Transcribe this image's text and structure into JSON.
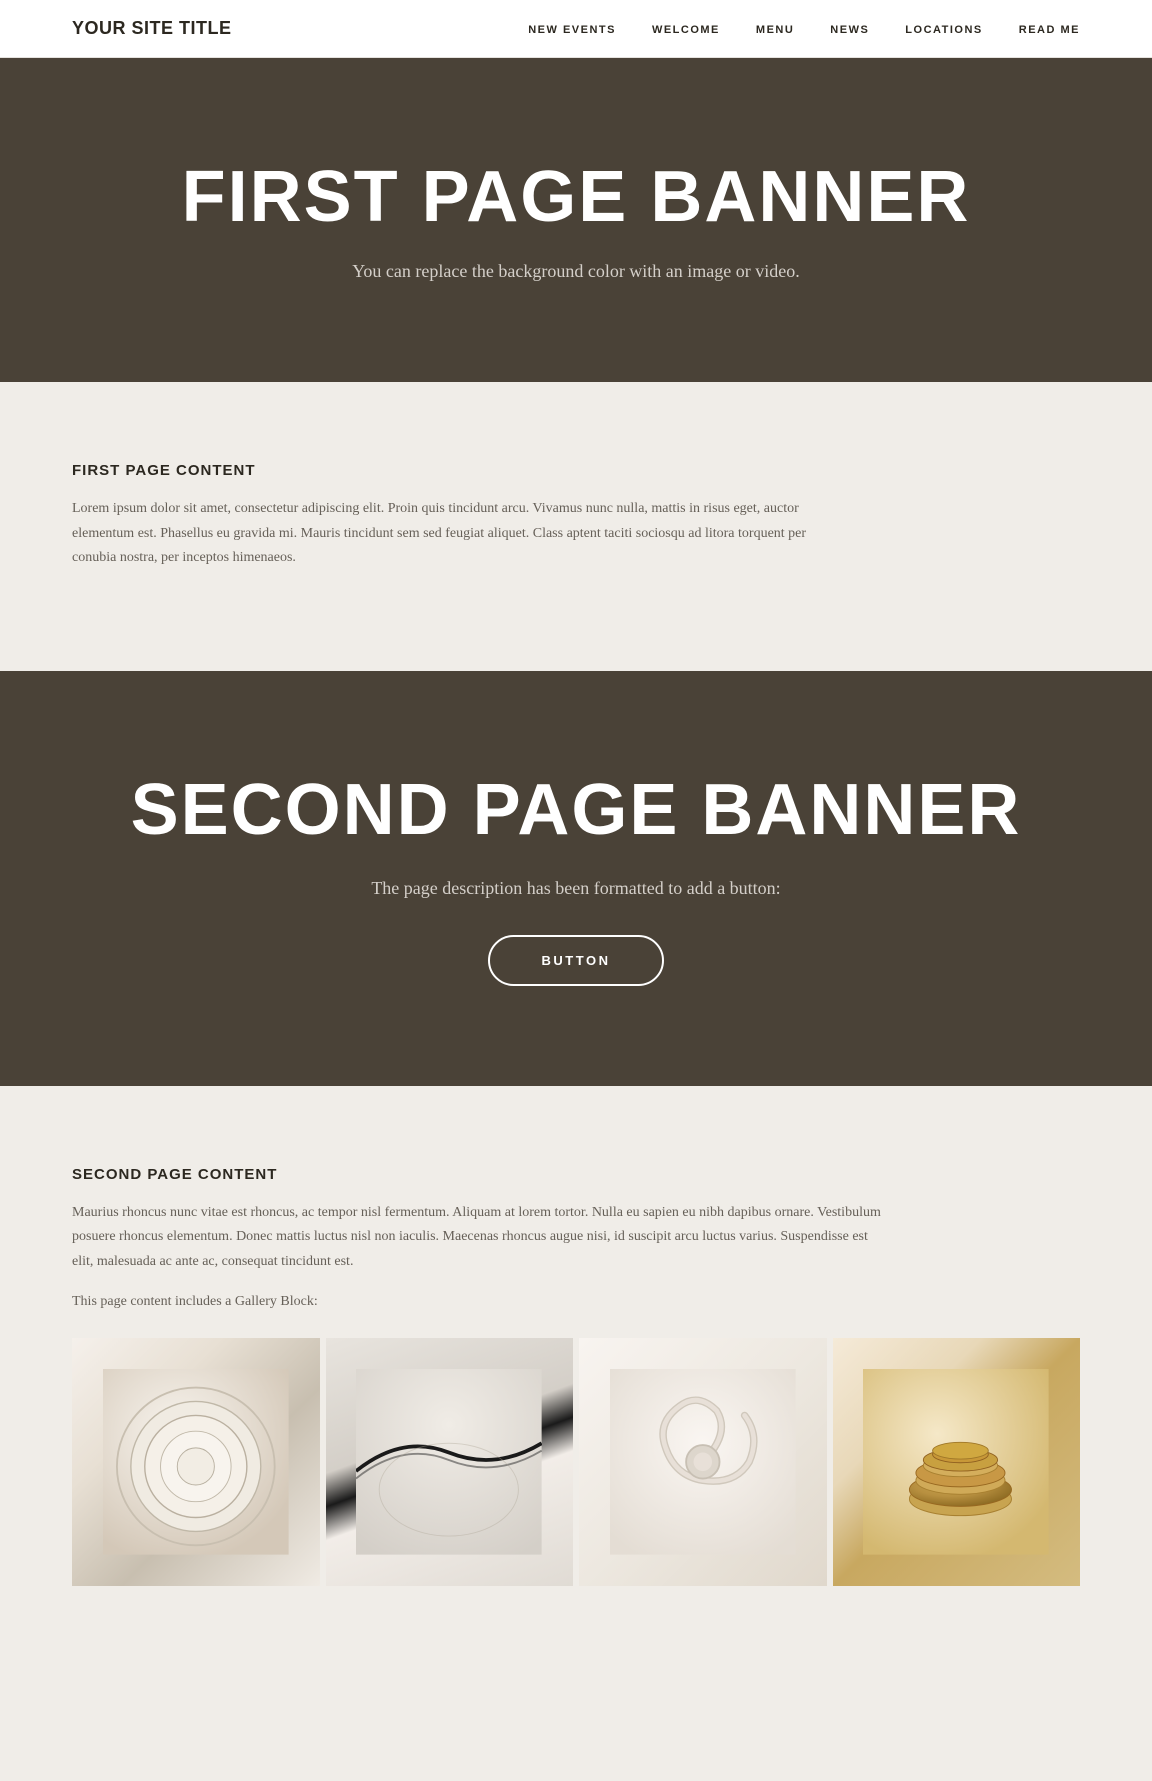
{
  "site": {
    "title": "Your Site Title"
  },
  "nav": {
    "links": [
      {
        "label": "New Events",
        "href": "#"
      },
      {
        "label": "Welcome",
        "href": "#"
      },
      {
        "label": "Menu",
        "href": "#"
      },
      {
        "label": "News",
        "href": "#"
      },
      {
        "label": "Locations",
        "href": "#"
      },
      {
        "label": "Read Me",
        "href": "#"
      }
    ]
  },
  "first_banner": {
    "heading": "First Page Banner",
    "description": "You can replace the background color with an image or video."
  },
  "first_content": {
    "heading": "First Page Content",
    "body": "Lorem ipsum dolor sit amet, consectetur adipiscing elit. Proin quis tincidunt arcu. Vivamus nunc nulla, mattis in risus eget, auctor elementum est. Phasellus eu gravida mi. Mauris tincidunt sem sed feugiat aliquet. Class aptent taciti sociosqu ad litora torquent per conubia nostra, per inceptos himenaeos."
  },
  "second_banner": {
    "heading": "Second Page Banner",
    "description": "The page description has been formatted to add a button:",
    "button_label": "Button"
  },
  "second_content": {
    "heading": "Second Page Content",
    "body": "Maurius rhoncus nunc vitae est rhoncus, ac tempor nisl fermentum. Aliquam at lorem tortor. Nulla eu sapien eu nibh dapibus ornare. Vestibulum posuere rhoncus elementum. Donec mattis luctus nisl non iaculis. Maecenas rhoncus augue nisi, id suscipit arcu luctus varius. Suspendisse est elit, malesuada ac ante ac, consequat tincidunt est.",
    "gallery_label": "This page content includes a Gallery Block:",
    "gallery": [
      {
        "id": 1,
        "alt": "Ceramic plate 1"
      },
      {
        "id": 2,
        "alt": "Ceramic plate 2"
      },
      {
        "id": 3,
        "alt": "Ceramic plate 3"
      },
      {
        "id": 4,
        "alt": "Ceramic plate 4"
      }
    ]
  }
}
